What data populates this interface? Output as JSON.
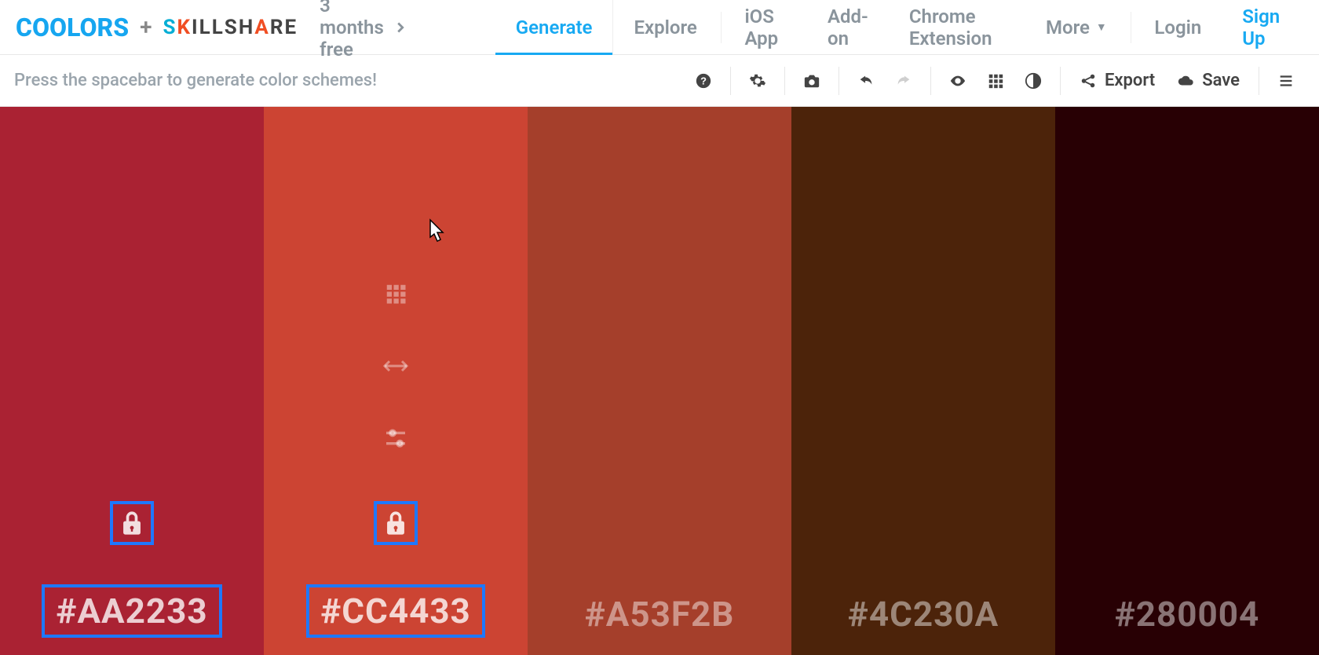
{
  "nav": {
    "logo": "COOLORS",
    "plus": "+",
    "skillshare": "SKILLSHARE",
    "promo": "3 months free",
    "links": {
      "generate": "Generate",
      "explore": "Explore",
      "ios": "iOS App",
      "addon": "Add-on",
      "chrome": "Chrome Extension",
      "more": "More",
      "login": "Login",
      "signup": "Sign Up"
    }
  },
  "toolbar": {
    "hint": "Press the spacebar to generate color schemes!",
    "export": "Export",
    "save": "Save"
  },
  "palette": {
    "colors": [
      {
        "hex": "#AA2233",
        "bg": "#AA2233",
        "locked": true,
        "selected": true,
        "showTools": false
      },
      {
        "hex": "#CC4433",
        "bg": "#CC4433",
        "locked": true,
        "selected": true,
        "showTools": true
      },
      {
        "hex": "#A53F2B",
        "bg": "#A53F2B",
        "locked": false,
        "selected": false,
        "showTools": false
      },
      {
        "hex": "#4C230A",
        "bg": "#4C230A",
        "locked": false,
        "selected": false,
        "showTools": false
      },
      {
        "hex": "#280004",
        "bg": "#280004",
        "locked": false,
        "selected": false,
        "showTools": false
      }
    ]
  }
}
